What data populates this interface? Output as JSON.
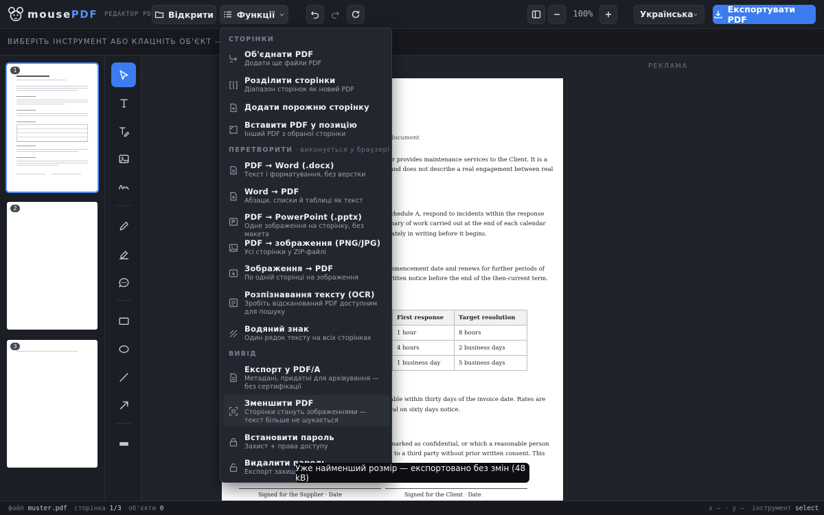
{
  "app": {
    "name_a": "mouse",
    "name_b": "PDF",
    "subtitle": "РЕДАКТОР PDF"
  },
  "toolbar": {
    "open_label": "Відкрити",
    "functions_label": "Функції",
    "zoom": "100%",
    "language": "Українська",
    "export_label": "Експортувати PDF"
  },
  "hint": "ВИБЕРІТЬ ІНСТРУМЕНТ АБО КЛАЦНІТЬ ОБ'ЄКТ — ТУТ З'ЯВ",
  "thumbnails": [
    "1",
    "2",
    "3"
  ],
  "ad_label": "РЕКЛАМА",
  "menu": {
    "sections": [
      {
        "label": "СТОРІНКИ",
        "note": ""
      },
      {
        "label": "ПЕРЕТВОРИТИ",
        "note": " · виконується у браузері"
      },
      {
        "label": "ВИВІД",
        "note": ""
      }
    ],
    "items": [
      {
        "title": "Об'єднати PDF",
        "sub": "Додати ще файли PDF",
        "icon": "merge-icon"
      },
      {
        "title": "Розділити сторінки",
        "sub": "Діапазон сторінок як новий PDF",
        "icon": "split-icon"
      },
      {
        "title": "Додати порожню сторінку",
        "sub": "",
        "icon": "add-page-icon"
      },
      {
        "title": "Вставити PDF у позицію",
        "sub": "Інший PDF з обраної сторінки",
        "icon": "insert-icon"
      },
      {
        "title": "PDF → Word (.docx)",
        "sub": "Текст і форматування, без верстки",
        "icon": "word-icon"
      },
      {
        "title": "Word → PDF",
        "sub": "Абзаци, списки й таблиці як текст",
        "icon": "word-to-pdf-icon"
      },
      {
        "title": "PDF → PowerPoint (.pptx)",
        "sub": "Одне зображення на сторінку, без макета",
        "icon": "powerpoint-icon"
      },
      {
        "title": "PDF → зображення (PNG/JPG)",
        "sub": "Усі сторінки у ZIP-файлі",
        "icon": "image-icon"
      },
      {
        "title": "Зображення → PDF",
        "sub": "По одній сторінці на зображення",
        "icon": "image-to-pdf-icon"
      },
      {
        "title": "Розпізнавання тексту (OCR)",
        "sub": "Зробіть відсканований PDF доступним для пошуку",
        "icon": "ocr-icon"
      },
      {
        "title": "Водяний знак",
        "sub": "Один рядок тексту на всіх сторінках",
        "icon": "watermark-icon"
      },
      {
        "title": "Експорт у PDF/A",
        "sub": "Метадані, придатні для архівування — без сертифікації",
        "icon": "pdfa-icon"
      },
      {
        "title": "Зменшити PDF",
        "sub": "Сторінки стануть зображеннями — текст більше не шукається",
        "icon": "compress-icon"
      },
      {
        "title": "Встановити пароль",
        "sub": "Захист + права доступу",
        "icon": "lock-icon"
      },
      {
        "title": "Видалити пароль",
        "sub": "Експорт захище",
        "icon": "unlock-icon"
      }
    ]
  },
  "document": {
    "title_fragment": "document",
    "lines": [
      "er provides maintenance services to the Client. It is a",
      "and does not describe a real engagement between real",
      "chedule A, respond to incidents within the response",
      "mary of work carried out at the end of each calendar",
      "ately in writing before it begins.",
      "mmencement date and renews for further periods of",
      "ritten notice before the end of the then-current term.",
      "able within thirty days of the invoice date. Rates are",
      "ral on sixty days notice.",
      "marked as confidential, or which a reasonable person",
      "to a third party without prior written consent. This"
    ],
    "table": {
      "headers": [
        "First response",
        "Target resolution"
      ],
      "rows": [
        [
          "1 hour",
          "8 hours"
        ],
        [
          "4 hours",
          "2 business days"
        ],
        [
          "1 business day",
          "5 business days"
        ]
      ]
    },
    "sig_supplier": "Signed for the Supplier · Date",
    "sig_client": "Signed for the Client · Date"
  },
  "toast": "Уже найменший розмір — експортовано без змін (48 kB)",
  "status": {
    "file_label": "файл",
    "file": "muster.pdf",
    "page_label": "сторінка",
    "page": "1/3",
    "objects_label": "об'єкти",
    "objects": "0",
    "coords": "x — · y —",
    "tool_label": "інструмент",
    "tool": "select"
  },
  "colors": {
    "accent": "#3b7cf0",
    "background": "#16181d",
    "menu": "#23262e"
  }
}
